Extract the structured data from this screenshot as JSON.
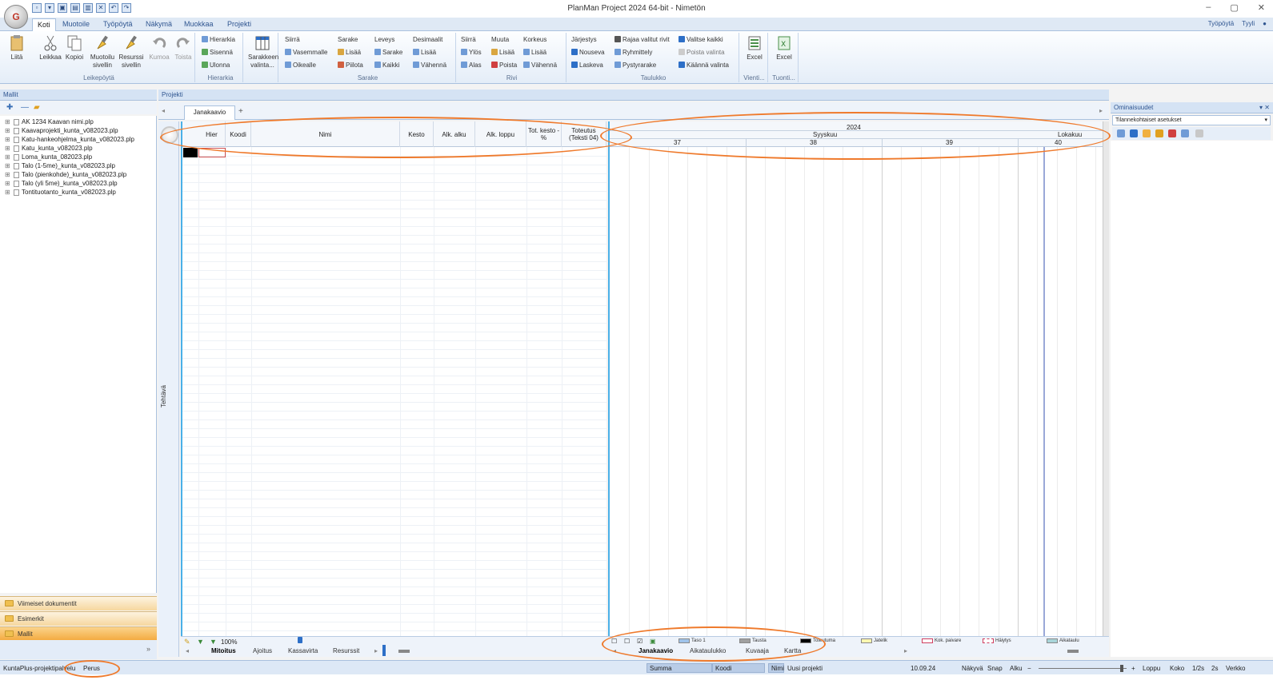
{
  "window": {
    "title": "PlanMan Project 2024 64-bit - Nimetön",
    "controls": [
      "–",
      "▢",
      "✕"
    ]
  },
  "quick_access": [
    "▫",
    "▾",
    "▣",
    "▤",
    "▥",
    "✕",
    "↶",
    "↷"
  ],
  "ribbon_tabs": [
    "Koti",
    "Muotoile",
    "Työpöytä",
    "Näkymä",
    "Muokkaa",
    "Projekti"
  ],
  "ribbon_right": [
    "Työpöytä",
    "Tyyli"
  ],
  "ribbon": {
    "leikepoyta": {
      "title": "Leikepöytä",
      "liita": "Liitä",
      "leikkaa": "Leikkaa",
      "kopioi": "Kopioi",
      "muotoilu": "Muotoilu sivellin",
      "resurssi": "Resurssi sivellin",
      "kumoa": "Kumoa",
      "toista": "Toista"
    },
    "hierarkia": {
      "title": "Hierarkia",
      "hierarkia": "Hierarkia",
      "sisenna": "Sisennä",
      "ulonna": "Ulonna"
    },
    "sarakkeen": {
      "label": "Sarakkeen valinta..."
    },
    "sarake": {
      "title": "Sarake",
      "siirra": "Siirrä",
      "vasemmalle": "Vasemmalle",
      "oikealle": "Oikealle",
      "sarake": "Sarake",
      "lisaa": "Lisää",
      "piilota": "Piilota",
      "leveys": "Leveys",
      "sarake2": "Sarake",
      "kaikki": "Kaikki",
      "desimaalit": "Desimaalit",
      "lisaa2": "Lisää",
      "vahenna": "Vähennä"
    },
    "rivi": {
      "title": "Rivi",
      "siirra": "Siirrä",
      "ylos": "Ylös",
      "alas": "Alas",
      "muuta": "Muuta",
      "lisaa": "Lisää",
      "poista": "Poista",
      "korkeus": "Korkeus",
      "lisaa2": "Lisää",
      "vahenna": "Vähennä"
    },
    "taulukko": {
      "title": "Taulukko",
      "jarjestys": "Järjestys",
      "nouseva": "Nouseva",
      "laskeva": "Laskeva",
      "rajaa": "Rajaa valitut rivit",
      "ryhmittely": "Ryhmittely",
      "pystyrarake": "Pystyrarake",
      "valitse": "Valitse kaikki",
      "poista": "Poista valinta",
      "kaanna": "Käännä valinta"
    },
    "vienti": {
      "title": "Vienti...",
      "excel": "Excel"
    },
    "tuonti": {
      "title": "Tuonti...",
      "excel": "Excel"
    }
  },
  "left_panel": {
    "title": "Mallit",
    "tools": [
      "✚",
      "—",
      "▰"
    ],
    "templates": [
      "AK 1234 Kaavan nimi.plp",
      "Kaavaprojekti_kunta_v082023.plp",
      "Katu-hankeohjelma_kunta_v082023.plp",
      "Katu_kunta_v082023.plp",
      "Loma_kunta_082023.plp",
      "Talo (1-5me)_kunta_v082023.plp",
      "Talo (pienkohde)_kunta_v082023.plp",
      "Talo (yli 5me)_kunta_v082023.plp",
      "Tontituotanto_kunta_v082023.plp"
    ],
    "nav": [
      "Viimeiset dokumentit",
      "Esimerkit",
      "Mallit"
    ],
    "collapse": "»"
  },
  "project": {
    "title": "Projekti",
    "doc_tab": "Janakaavio",
    "add_tab": "+",
    "side_label": "Tehtävä"
  },
  "grid": {
    "columns": [
      "Hier",
      "Koodi",
      "Nimi",
      "Kesto",
      "Alk. alku",
      "Alk. loppu",
      "Tot. kesto -%",
      "Toteutus (Teksti 04)"
    ]
  },
  "gantt": {
    "year": "2024",
    "months": [
      "Syyskuu",
      "Lokakuu"
    ],
    "weeks": [
      "37",
      "38",
      "39",
      "40"
    ]
  },
  "grid_bottom": {
    "zoom": "100%",
    "tabs": [
      "Mitoitus",
      "Ajoitus",
      "Kassavirta",
      "Resurssit"
    ]
  },
  "gantt_bottom": {
    "legend": [
      {
        "label": "Taso 1",
        "color": "#9fc3ea"
      },
      {
        "label": "Tausta",
        "color": "#a0a0a0"
      },
      {
        "label": "Toteutuma",
        "color": "#000000"
      },
      {
        "label": "Jatelik",
        "color": "#fff7b0"
      },
      {
        "label": "Kok. paivare",
        "color": "#ffffff"
      },
      {
        "label": "Häiytys",
        "color": "#ffffff"
      },
      {
        "label": "Aikataulu",
        "color": "#a8d4d8"
      }
    ],
    "tabs": [
      "Janakaavio",
      "Aikataulukko",
      "Kuvaaja",
      "Kartta"
    ]
  },
  "properties": {
    "title": "Ominaisuudet",
    "pin": "▾ ✕",
    "selector": "Tilannekohtaiset asetukset"
  },
  "status": {
    "left": "KuntaPlus-projektipalvelu",
    "profile": "Perus",
    "summa": "Summa",
    "koodi": "Koodi",
    "nimi_label": "Nimi",
    "nimi_value": "Uusi projekti",
    "date": "10.09.24",
    "items": [
      "Näkyvä",
      "Snap",
      "Alku"
    ],
    "zoom_minus": "−",
    "zoom_plus": "+",
    "right": [
      "Loppu",
      "Koko",
      "1/2s",
      "2s",
      "Verkko"
    ]
  },
  "colors": {
    "accent": "#2d6fc7",
    "annotation": "#ef7a2c",
    "selection": "#4ab0e8"
  }
}
